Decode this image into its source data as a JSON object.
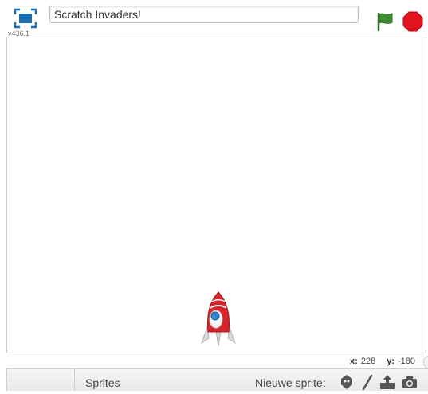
{
  "header": {
    "version": "v436.1",
    "project_title": "Scratch Invaders!",
    "fullscreen_icon": "fullscreen-icon",
    "green_flag_icon": "green-flag-icon",
    "stop_icon": "stop-icon"
  },
  "stage": {
    "sprite": "rocket-sprite"
  },
  "coordinates": {
    "x_label": "x:",
    "x_value": "228",
    "y_label": "y:",
    "y_value": "-180"
  },
  "sprites_panel": {
    "tab_label": "Sprites",
    "new_sprite_label": "Nieuwe sprite:",
    "new_sprite_buttons": [
      "library-icon",
      "paint-icon",
      "upload-icon",
      "camera-icon"
    ]
  },
  "colors": {
    "accent_blue": "#1c6fb7",
    "flag_green": "#3f8f32",
    "stop_red": "#e3131e",
    "rocket_red": "#d8232a"
  }
}
